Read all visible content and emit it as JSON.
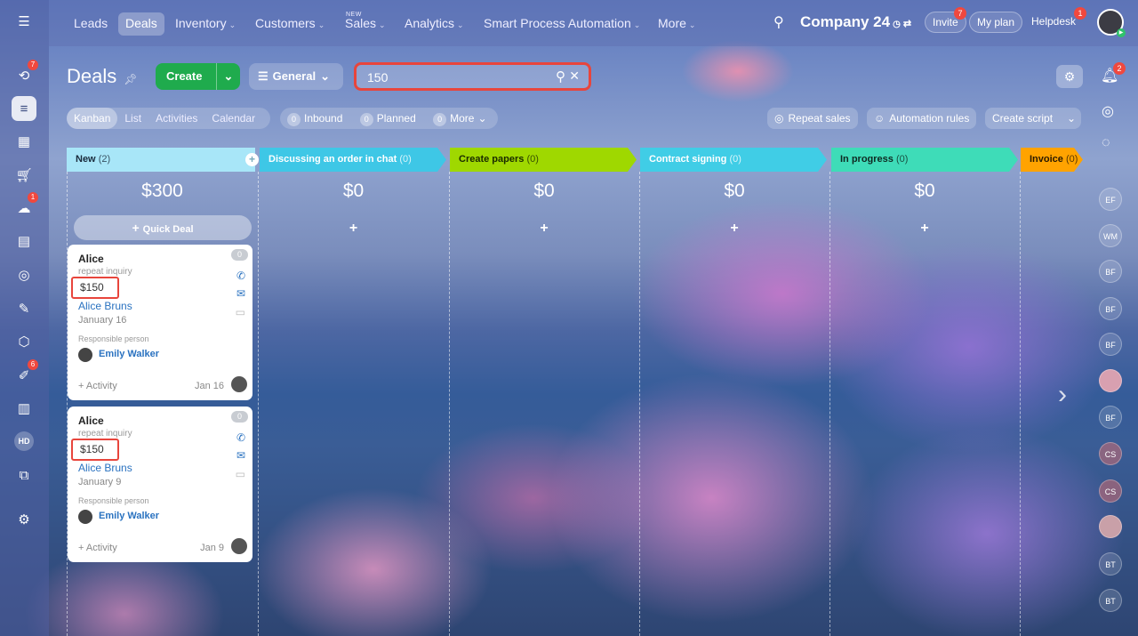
{
  "left_rail": {
    "badges": {
      "activity": "7",
      "robots": "1",
      "tasks": "6"
    },
    "hd": "HD"
  },
  "nav": {
    "items": [
      {
        "label": "Leads",
        "active": false
      },
      {
        "label": "Deals",
        "active": true
      },
      {
        "label": "Inventory",
        "active": false
      },
      {
        "label": "Customers",
        "active": false
      },
      {
        "label": "Sales",
        "active": false,
        "tag": "NEW"
      },
      {
        "label": "Analytics",
        "active": false
      },
      {
        "label": "Smart Process Automation",
        "active": false
      },
      {
        "label": "More",
        "active": false
      }
    ],
    "company": "Company 24",
    "invite": "Invite",
    "invite_badge": "7",
    "plan": "My plan",
    "helpdesk": "Helpdesk",
    "helpdesk_badge": "1",
    "notif_badge": "2"
  },
  "header": {
    "title": "Deals",
    "create_label": "Create",
    "filter_label": "General",
    "search_value": "150"
  },
  "views": {
    "tabs": [
      "Kanban",
      "List",
      "Activities",
      "Calendar"
    ],
    "counters": [
      {
        "count": "0",
        "label": "Inbound"
      },
      {
        "count": "0",
        "label": "Planned"
      },
      {
        "count": "0",
        "label": "More"
      }
    ],
    "repeat_sales": "Repeat sales",
    "automation": "Automation rules",
    "create_script": "Create script"
  },
  "columns": [
    {
      "title": "New",
      "count": "(2)",
      "sum": "$300",
      "color": "#a8e6f8",
      "text": "#1a2b3c"
    },
    {
      "title": "Discussing an order in chat",
      "count": "(0)",
      "sum": "$0",
      "color": "#3ec7e6",
      "text": "#ffffff"
    },
    {
      "title": "Create papers",
      "count": "(0)",
      "sum": "$0",
      "color": "#9fd800",
      "text": "#1a2b00"
    },
    {
      "title": "Contract signing",
      "count": "(0)",
      "sum": "$0",
      "color": "#40cde6",
      "text": "#ffffff"
    },
    {
      "title": "In progress",
      "count": "(0)",
      "sum": "$0",
      "color": "#3edcb8",
      "text": "#0f2a22"
    },
    {
      "title": "Invoice",
      "count": "(0)",
      "sum": "",
      "color": "#ffa300",
      "text": "#2a1a00"
    }
  ],
  "quick_deal": "Quick Deal",
  "cards": [
    {
      "name": "Alice",
      "subtitle": "repeat inquiry",
      "amount": "$150",
      "contact": "Alice Bruns",
      "date": "January 16",
      "responsible_label": "Responsible person",
      "responsible": "Emily Walker",
      "activity": "+ Activity",
      "activity_date": "Jan 16",
      "counter": "0"
    },
    {
      "name": "Alice",
      "subtitle": "repeat inquiry",
      "amount": "$150",
      "contact": "Alice Bruns",
      "date": "January 9",
      "responsible_label": "Responsible person",
      "responsible": "Emily Walker",
      "activity": "+ Activity",
      "activity_date": "Jan 9",
      "counter": "0"
    }
  ],
  "right_rail": {
    "avatars": [
      "EF",
      "WM",
      "BF",
      "BF",
      "BF",
      "",
      "BF",
      "CS",
      "CS",
      "",
      "BT",
      "BT"
    ]
  }
}
